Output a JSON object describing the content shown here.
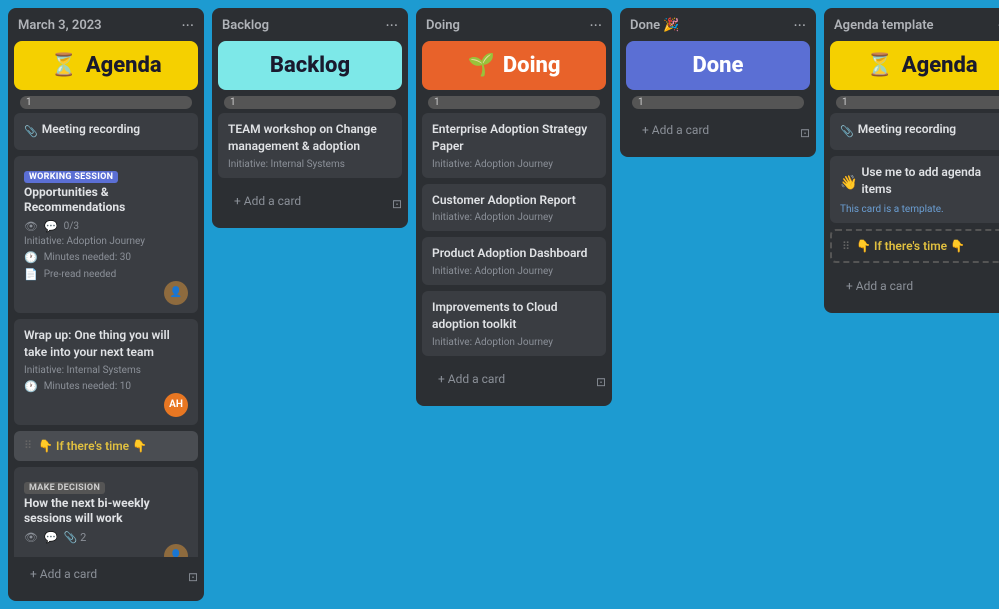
{
  "columns": [
    {
      "id": "agenda",
      "header_title": "March 3, 2023",
      "banner_type": "agenda",
      "banner_emoji": "⏳",
      "banner_label": "Agenda",
      "count": 1,
      "cards": [
        {
          "type": "meeting-recording",
          "title": "Meeting recording",
          "has_clip": true
        },
        {
          "type": "working-session",
          "badge": "WORKING SESSION",
          "badge_type": "working",
          "title": "Opportunities & Recommendations",
          "meta": [
            "eye",
            "chat",
            "0/3"
          ],
          "initiative": "Initiative: Adoption Journey",
          "minutes": "Minutes needed: 30",
          "pre_read": "Pre-read needed",
          "has_avatar": true,
          "avatar_type": "img"
        },
        {
          "type": "regular",
          "title": "Wrap up: One thing you will take into your next team",
          "initiative": "Initiative: Internal Systems",
          "minutes": "Minutes needed: 10",
          "has_avatar": true,
          "avatar_type": "orange",
          "avatar_text": "AH"
        }
      ],
      "section_label": "👇 If there's time 👇",
      "section_cards": [
        {
          "type": "decision",
          "badge": "MAKE DECISION",
          "badge_type": "decision",
          "title": "How the next bi-weekly sessions will work",
          "meta_icons": [
            "eye",
            "chat",
            "clip-2"
          ],
          "has_avatar": true,
          "avatar_type": "img"
        }
      ],
      "add_label": "+ Add a card"
    },
    {
      "id": "backlog",
      "header_title": "Backlog",
      "banner_type": "backlog",
      "banner_label": "Backlog",
      "count": 1,
      "cards": [
        {
          "type": "regular",
          "title": "TEAM workshop on Change management & adoption",
          "initiative": "Initiative: Internal Systems"
        }
      ],
      "add_label": "+ Add a card"
    },
    {
      "id": "doing",
      "header_title": "Doing",
      "banner_type": "doing",
      "banner_emoji": "🌱",
      "banner_label": "Doing",
      "count": 1,
      "cards": [
        {
          "type": "regular",
          "title": "Enterprise Adoption Strategy Paper",
          "initiative": "Initiative: Adoption Journey"
        },
        {
          "type": "regular",
          "title": "Customer Adoption Report",
          "initiative": "Initiative: Adoption Journey"
        },
        {
          "type": "regular",
          "title": "Product Adoption Dashboard",
          "initiative": "Initiative: Adoption Journey"
        },
        {
          "type": "regular",
          "title": "Improvements to Cloud adoption toolkit",
          "initiative": "Initiative: Adoption Journey"
        }
      ],
      "add_label": "+ Add a card"
    },
    {
      "id": "done",
      "header_title": "Done 🎉",
      "banner_type": "done",
      "banner_label": "Done",
      "count": 1,
      "cards": [],
      "add_label": "+ Add a card"
    },
    {
      "id": "agenda-template",
      "header_title": "Agenda template",
      "banner_type": "agenda-template",
      "banner_emoji": "⏳",
      "banner_label": "Agenda",
      "count": 1,
      "cards": [
        {
          "type": "meeting-recording",
          "title": "Meeting recording",
          "has_clip": true
        },
        {
          "type": "template-note",
          "emoji": "👋",
          "title": "Use me to add agenda items",
          "note": "This card is a template."
        }
      ],
      "section_label": "👇 If there's time 👇",
      "section_cards": [],
      "add_label": "+ Add a card"
    }
  ]
}
